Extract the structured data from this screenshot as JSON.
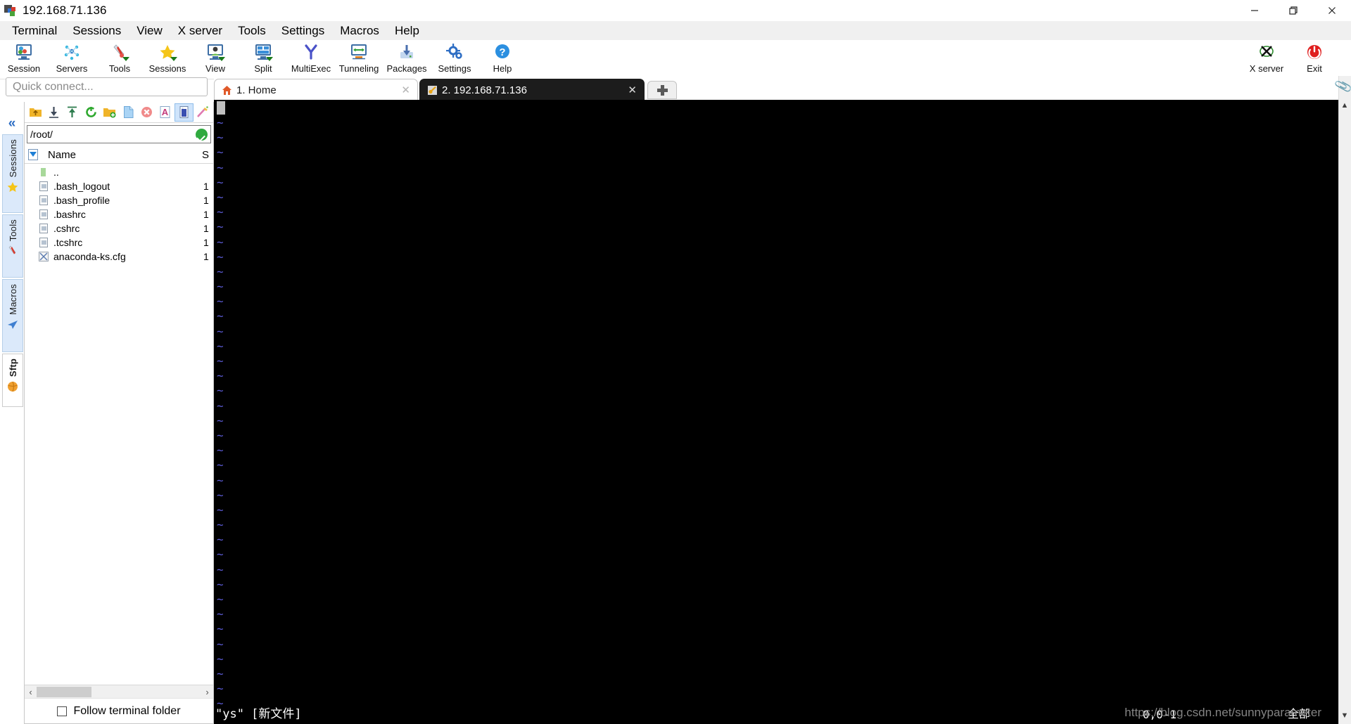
{
  "window": {
    "title": "192.168.71.136",
    "app_icon": "mobaxterm-icon",
    "controls": {
      "minimize": "minimize-icon",
      "maximize": "restore-icon",
      "close": "close-icon"
    }
  },
  "menubar": {
    "items": [
      {
        "label": "Terminal"
      },
      {
        "label": "Sessions"
      },
      {
        "label": "View"
      },
      {
        "label": "X server"
      },
      {
        "label": "Tools"
      },
      {
        "label": "Settings"
      },
      {
        "label": "Macros"
      },
      {
        "label": "Help"
      }
    ]
  },
  "ribbon": {
    "buttons": [
      {
        "label": "Session",
        "icon": "session-icon"
      },
      {
        "label": "Servers",
        "icon": "servers-icon"
      },
      {
        "label": "Tools",
        "icon": "tools-icon"
      },
      {
        "label": "Sessions",
        "icon": "sessions-star-icon"
      },
      {
        "label": "View",
        "icon": "view-icon"
      },
      {
        "label": "Split",
        "icon": "split-icon"
      },
      {
        "label": "MultiExec",
        "icon": "multiexec-icon"
      },
      {
        "label": "Tunneling",
        "icon": "tunneling-icon"
      },
      {
        "label": "Packages",
        "icon": "packages-icon"
      },
      {
        "label": "Settings",
        "icon": "settings-gear-icon"
      },
      {
        "label": "Help",
        "icon": "help-question-icon"
      }
    ],
    "right_buttons": [
      {
        "label": "X server",
        "icon": "xserver-icon"
      },
      {
        "label": "Exit",
        "icon": "power-exit-icon"
      }
    ]
  },
  "quick_connect": {
    "placeholder": "Quick connect...",
    "value": ""
  },
  "side_tabs": {
    "collapse_icon": "double-chevron-left-icon",
    "items": [
      {
        "label": "Sessions",
        "icon": "star-icon",
        "active": false
      },
      {
        "label": "Tools",
        "icon": "tools-icon",
        "active": false
      },
      {
        "label": "Macros",
        "icon": "paperplane-icon",
        "active": false
      },
      {
        "label": "Sftp",
        "icon": "globe-icon",
        "active": true
      }
    ]
  },
  "sftp": {
    "toolbar": [
      {
        "icon": "folder-up-icon",
        "name": "parent-folder"
      },
      {
        "icon": "download-icon",
        "name": "download"
      },
      {
        "icon": "upload-icon",
        "name": "upload"
      },
      {
        "icon": "refresh-icon",
        "name": "refresh"
      },
      {
        "icon": "new-folder-icon",
        "name": "new-folder"
      },
      {
        "icon": "new-file-icon",
        "name": "new-file"
      },
      {
        "icon": "delete-icon",
        "name": "delete"
      },
      {
        "icon": "text-mode-icon",
        "name": "text-mode"
      },
      {
        "icon": "binary-mode-icon",
        "name": "binary-mode",
        "selected": true
      },
      {
        "icon": "edit-magic-icon",
        "name": "edit"
      }
    ],
    "path": "/root/",
    "path_status_icon": "ok-check-icon",
    "columns": [
      {
        "label": "Name"
      },
      {
        "label": "S"
      }
    ],
    "sort_icon": "sort-descending-icon",
    "files": [
      {
        "name": "..",
        "size": "",
        "icon": "folder-up-icon"
      },
      {
        "name": ".bash_logout",
        "size": "1",
        "icon": "file-icon"
      },
      {
        "name": ".bash_profile",
        "size": "1",
        "icon": "file-icon"
      },
      {
        "name": ".bashrc",
        "size": "1",
        "icon": "file-icon"
      },
      {
        "name": ".cshrc",
        "size": "1",
        "icon": "file-icon"
      },
      {
        "name": ".tcshrc",
        "size": "1",
        "icon": "file-icon"
      },
      {
        "name": "anaconda-ks.cfg",
        "size": "1",
        "icon": "config-file-icon"
      }
    ],
    "hscroll": {
      "left_icon": "chevron-left-icon",
      "right_icon": "chevron-right-icon"
    },
    "follow_terminal_folder": {
      "label": "Follow terminal folder",
      "checked": false
    }
  },
  "tabs": {
    "items": [
      {
        "label": "1. Home",
        "icon": "home-icon",
        "active": false,
        "close_icon": "close-icon"
      },
      {
        "label": "2. 192.168.71.136",
        "icon": "ssh-key-icon",
        "active": true,
        "close_icon": "close-icon"
      }
    ],
    "new_tab_icon": "plus-icon"
  },
  "terminal": {
    "empty_line_marker": "~",
    "empty_line_count": 40,
    "status_line": "\"ys\" [新文件]",
    "ruler": "0,0-1",
    "position_label": "全部",
    "watermark": "https://blog.csdn.net/sunnyparameter"
  },
  "right_panel": {
    "clip_icon": "paperclip-icon",
    "scroll_up_icon": "chevron-up-icon",
    "scroll_down_icon": "chevron-down-icon"
  },
  "colors": {
    "accent": "#2e6ec4",
    "terminal_bg": "#000000",
    "tilde": "#5c5cd6",
    "active_tab_bg": "#1c1c1c",
    "ok_green": "#2faa3f",
    "exit_red": "#e01e1e"
  }
}
